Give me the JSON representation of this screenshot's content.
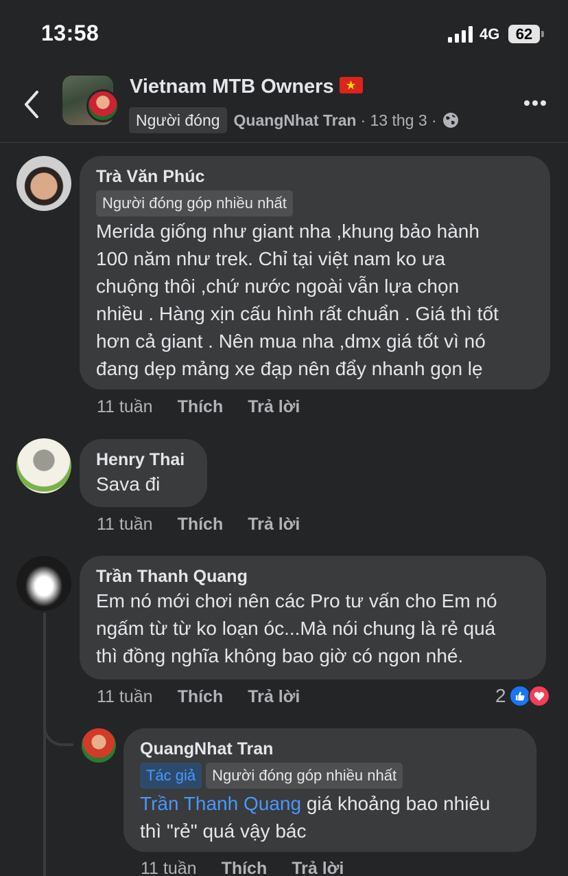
{
  "status_bar": {
    "time": "13:58",
    "network": "4G",
    "battery": "62"
  },
  "header": {
    "group_name": "Vietnam MTB Owners",
    "role": "Người đóng",
    "author": "QuangNhat Tran",
    "date": "· 13 thg 3 ·"
  },
  "comments": [
    {
      "name": "Trà Văn Phúc",
      "badge": "Người đóng góp nhiều nhất",
      "lines": [
        "Merida giống như giant nha ,khung bảo hành",
        "100 năm như trek. Chỉ tại việt nam ko ưa",
        "chuộng thôi ,chứ nước ngoài vẫn lựa chọn",
        "nhiều . Hàng xịn cấu hình rất chuẩn . Giá thì tốt",
        "hơn cả giant . Nên mua nha ,dmx giá tốt vì nó",
        "đang dẹp mảng xe đạp nên đẩy nhanh gọn lẹ"
      ],
      "time": "11 tuần",
      "like": "Thích",
      "reply": "Trả lời"
    },
    {
      "name": "Henry Thai",
      "lines": [
        "Sava  đi"
      ],
      "time": "11 tuần",
      "like": "Thích",
      "reply": "Trả lời"
    },
    {
      "name": "Trần Thanh Quang",
      "lines": [
        "Em nó mới chơi nên các Pro tư vấn cho Em nó",
        "ngấm từ từ ko loạn óc...Mà nói chung là rẻ quá",
        "thì đồng nghĩa không bao giờ có ngon nhé."
      ],
      "time": "11 tuần",
      "like": "Thích",
      "reply": "Trả lời",
      "reaction_count": "2"
    },
    {
      "name": "QuangNhat Tran",
      "badges": [
        "Tác giả",
        "Người đóng góp nhiều nhất"
      ],
      "mention": "Trần Thanh Quang",
      "line1_rest": " giá khoảng bao nhiêu",
      "line2": "thì  \"rẻ\" quá vậy bác",
      "time": "11 tuần",
      "like": "Thích",
      "reply": "Trả lời"
    }
  ],
  "colors": {
    "background": "#242526",
    "bubble": "#3a3b3c",
    "text": "#e4e6eb",
    "secondary_text": "#b0b3b8",
    "link": "#4599ff",
    "like": "#1877f2",
    "love": "#f33e58"
  },
  "icons": [
    "back-chevron-icon",
    "globe-icon",
    "more-icon",
    "like-reaction-icon",
    "love-reaction-icon"
  ]
}
